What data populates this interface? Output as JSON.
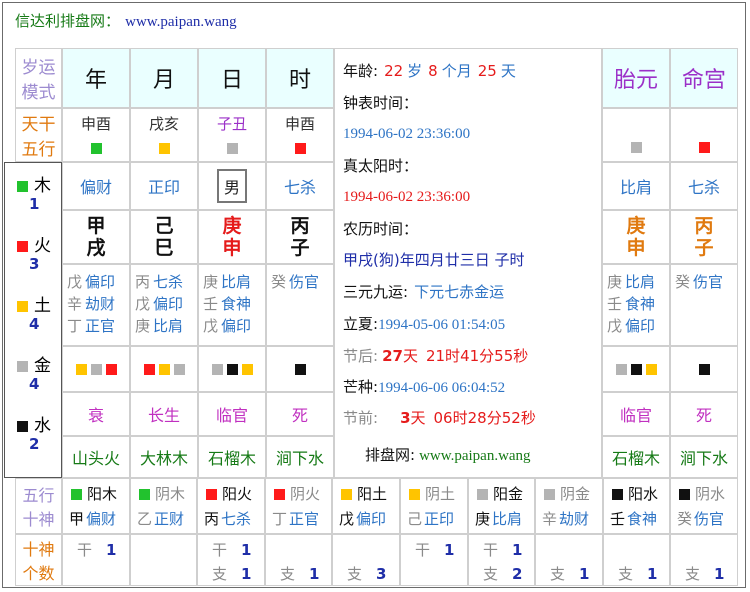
{
  "site": {
    "name": "信达利排盘网：",
    "url": "www.paipan.wang"
  },
  "colors": {
    "wood": "#22c22e",
    "fire": "#ff1a1a",
    "earth": "#ffc400",
    "metal": "#b4b4b4",
    "water": "#111111"
  },
  "row_labels": {
    "pillar": [
      "岁运",
      "模式"
    ],
    "stem_element": [
      "天干",
      "五行"
    ],
    "element_tenshen": [
      "五行",
      "十神"
    ],
    "tenshen_count": [
      "十神",
      "个数"
    ]
  },
  "elements": [
    {
      "name": "木",
      "count": "1",
      "color": "wood"
    },
    {
      "name": "火",
      "count": "3",
      "color": "fire"
    },
    {
      "name": "土",
      "count": "4",
      "color": "earth"
    },
    {
      "name": "金",
      "count": "4",
      "color": "metal"
    },
    {
      "name": "水",
      "count": "2",
      "color": "water"
    }
  ],
  "pillars": [
    {
      "header": "年",
      "pair": "申酉",
      "pair_color": "wood",
      "stem_god": "偏财",
      "stem": "甲",
      "branch": "戌",
      "hidden": [
        [
          "戊",
          "偏印"
        ],
        [
          "辛",
          "劫财"
        ],
        [
          "丁",
          "正官"
        ]
      ],
      "branch_colors": [
        "earth",
        "metal",
        "fire"
      ],
      "phase": "衰",
      "nayin": "山头火"
    },
    {
      "header": "月",
      "pair": "戌亥",
      "pair_color": "earth",
      "stem_god": "正印",
      "stem": "己",
      "branch": "巳",
      "hidden": [
        [
          "丙",
          "七杀"
        ],
        [
          "戊",
          "偏印"
        ],
        [
          "庚",
          "比肩"
        ]
      ],
      "branch_colors": [
        "fire",
        "earth",
        "metal"
      ],
      "phase": "长生",
      "nayin": "大林木"
    },
    {
      "header": "日",
      "pair": "子丑",
      "pair_color": "metal",
      "stem_god": "男",
      "stem": "庚",
      "branch": "申",
      "hidden": [
        [
          "庚",
          "比肩"
        ],
        [
          "壬",
          "食神"
        ],
        [
          "戊",
          "偏印"
        ]
      ],
      "branch_colors": [
        "metal",
        "water",
        "earth"
      ],
      "phase": "临官",
      "nayin": "石榴木"
    },
    {
      "header": "时",
      "pair": "申酉",
      "pair_color": "fire",
      "stem_god": "七杀",
      "stem": "丙",
      "branch": "子",
      "hidden": [
        [
          "癸",
          "伤官"
        ]
      ],
      "branch_colors": [
        "water"
      ],
      "phase": "死",
      "nayin": "涧下水"
    }
  ],
  "side_pillars": [
    {
      "header": "胎元",
      "pair_color": "metal",
      "stem_god": "比肩",
      "stem": "庚",
      "branch": "申",
      "hidden": [
        [
          "庚",
          "比肩"
        ],
        [
          "壬",
          "食神"
        ],
        [
          "戊",
          "偏印"
        ]
      ],
      "branch_colors": [
        "metal",
        "water",
        "earth"
      ],
      "phase": "临官",
      "nayin": "石榴木"
    },
    {
      "header": "命宫",
      "pair_color": "fire",
      "stem_god": "七杀",
      "stem": "丙",
      "branch": "子",
      "hidden": [
        [
          "癸",
          "伤官"
        ]
      ],
      "branch_colors": [
        "water"
      ],
      "phase": "死",
      "nayin": "涧下水"
    }
  ],
  "info": {
    "age_label": "年龄:",
    "age_years": "22",
    "age_y_unit": "岁",
    "age_months": "8",
    "age_m_unit": "个月",
    "age_days": "25",
    "age_d_unit": "天",
    "clock_label": "钟表时间：",
    "clock_value": "1994-06-02 23:36:00",
    "solar_label": "真太阳时：",
    "solar_value": "1994-06-02 23:36:00",
    "lunar_label": "农历时间：",
    "lunar_value": "甲戌(狗)年四月廿三日 子时",
    "sanyuan_label": "三元九运:",
    "sanyuan_value": "下元七赤金运",
    "lixia_label": "立夏:",
    "lixia_value": "1994-05-06 01:54:05",
    "after_label": "节后:",
    "after_days": "27",
    "after_d": "天",
    "after_hours": "21",
    "after_h": "时",
    "after_mins": "41",
    "after_m": "分",
    "after_secs": "55",
    "after_s": "秒",
    "mangzhong_label": "芒种:",
    "mangzhong_value": "1994-06-06 06:04:52",
    "before_label": "节前:",
    "before_days": "3",
    "before_d": "天",
    "before_hours": "06",
    "before_h": "时",
    "before_mins": "28",
    "before_m": "分",
    "before_secs": "52",
    "before_s": "秒",
    "site_label": "排盘网:",
    "site_url": "www.paipan.wang"
  },
  "element_gods": [
    {
      "color": "wood",
      "element": "阳木",
      "stem": "甲",
      "god": "偏财",
      "gan": "干",
      "gan_count": "1",
      "zhi": "",
      "zhi_count": ""
    },
    {
      "color": "wood",
      "element": "阴木",
      "stem": "乙",
      "god": "正财",
      "gan": "",
      "gan_count": "",
      "zhi": "",
      "zhi_count": ""
    },
    {
      "color": "fire",
      "element": "阳火",
      "stem": "丙",
      "god": "七杀",
      "gan": "干",
      "gan_count": "1",
      "zhi": "支",
      "zhi_count": "1"
    },
    {
      "color": "fire",
      "element": "阴火",
      "stem": "丁",
      "god": "正官",
      "gan": "",
      "gan_count": "",
      "zhi": "支",
      "zhi_count": "1"
    },
    {
      "color": "earth",
      "element": "阳土",
      "stem": "戊",
      "god": "偏印",
      "gan": "",
      "gan_count": "",
      "zhi": "支",
      "zhi_count": "3"
    },
    {
      "color": "earth",
      "element": "阴土",
      "stem": "己",
      "god": "正印",
      "gan": "干",
      "gan_count": "1",
      "zhi": "",
      "zhi_count": ""
    },
    {
      "color": "metal",
      "element": "阳金",
      "stem": "庚",
      "god": "比肩",
      "gan": "干",
      "gan_count": "1",
      "zhi": "支",
      "zhi_count": "2"
    },
    {
      "color": "metal",
      "element": "阴金",
      "stem": "辛",
      "god": "劫财",
      "gan": "",
      "gan_count": "",
      "zhi": "支",
      "zhi_count": "1"
    },
    {
      "color": "water",
      "element": "阳水",
      "stem": "壬",
      "god": "食神",
      "gan": "",
      "gan_count": "",
      "zhi": "支",
      "zhi_count": "1"
    },
    {
      "color": "water",
      "element": "阴水",
      "stem": "癸",
      "god": "伤官",
      "gan": "",
      "gan_count": "",
      "zhi": "支",
      "zhi_count": "1"
    }
  ]
}
